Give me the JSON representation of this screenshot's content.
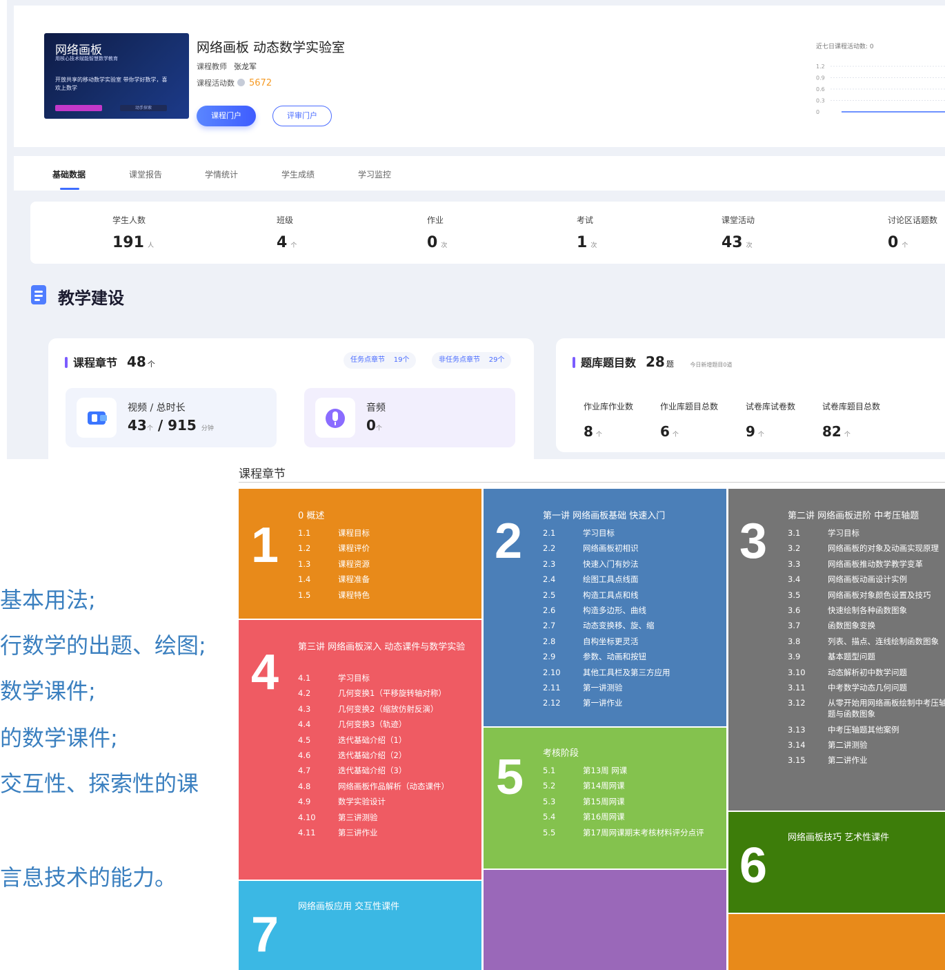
{
  "header": {
    "thumbnail": {
      "title": "网络画板",
      "subtitle": "用核心技术赋能智慧数学教育",
      "slogan": "开放共享的移动数学实验室 带你学好数学，喜欢上数学",
      "button_right": "动手探索"
    },
    "course_title": "网络画板 动态数学实验室",
    "teacher_label": "课程教师",
    "teacher_name": "张龙军",
    "activity_label": "课程活动数",
    "activity_value": "5672",
    "primary_button": "课程门户",
    "secondary_button": "评审门户",
    "mini_chart": {
      "caption": "近七日课程活动数: 0",
      "y_ticks": [
        "1.2",
        "0.9",
        "0.6",
        "0.3",
        "0"
      ]
    }
  },
  "tabs": [
    {
      "label": "基础数据",
      "active": true
    },
    {
      "label": "课堂报告",
      "active": false
    },
    {
      "label": "学情统计",
      "active": false
    },
    {
      "label": "学生成绩",
      "active": false
    },
    {
      "label": "学习监控",
      "active": false
    }
  ],
  "stats": [
    {
      "label": "学生人数",
      "value": "191",
      "unit": "人"
    },
    {
      "label": "班级",
      "value": "4",
      "unit": "个"
    },
    {
      "label": "作业",
      "value": "0",
      "unit": "次"
    },
    {
      "label": "考试",
      "value": "1",
      "unit": "次"
    },
    {
      "label": "课堂活动",
      "value": "43",
      "unit": "次"
    },
    {
      "label": "讨论区话题数",
      "value": "0",
      "unit": "个"
    }
  ],
  "section_title": "教学建设",
  "chapters_card": {
    "title": "课程章节",
    "count": "48",
    "count_unit": "个",
    "pill_task": "任务点章节",
    "pill_task_value": "19个",
    "pill_nontask": "非任务点章节",
    "pill_nontask_value": "29个",
    "video_label": "视频 / 总时长",
    "video_count": "43",
    "video_count_unit": "个",
    "video_duration": "915",
    "video_duration_unit": "分钟",
    "audio_label": "音频",
    "audio_value": "0",
    "audio_unit": "个"
  },
  "question_bank": {
    "title": "题库题目数",
    "count": "28",
    "count_unit": "题",
    "today": "今日新增题目0道",
    "stats": [
      {
        "label": "作业库作业数",
        "value": "8",
        "unit": "个"
      },
      {
        "label": "作业库题目总数",
        "value": "6",
        "unit": "个"
      },
      {
        "label": "试卷库试卷数",
        "value": "9",
        "unit": "个"
      },
      {
        "label": "试卷库题目总数",
        "value": "82",
        "unit": "个"
      }
    ]
  },
  "left_text": [
    "基本用法;",
    "行数学的出题、绘图;",
    "数学课件;",
    "的数学课件;",
    "交互性、探索性的课",
    "言息技术的能力。"
  ],
  "chapter_tiles": {
    "title": "课程章节",
    "tiles": [
      {
        "number": "1",
        "color": "#e88a1a",
        "heading": "0 概述",
        "items": [
          {
            "no": "1.1",
            "text": "课程目标"
          },
          {
            "no": "1.2",
            "text": "课程评价"
          },
          {
            "no": "1.3",
            "text": "课程资源"
          },
          {
            "no": "1.4",
            "text": "课程准备"
          },
          {
            "no": "1.5",
            "text": "课程特色"
          }
        ]
      },
      {
        "number": "2",
        "color": "#4b7fb8",
        "heading": "第一讲 网络画板基础 快速入门",
        "items": [
          {
            "no": "2.1",
            "text": "学习目标"
          },
          {
            "no": "2.2",
            "text": "网络画板初相识"
          },
          {
            "no": "2.3",
            "text": "快速入门有妙法"
          },
          {
            "no": "2.4",
            "text": "绘图工具点线面"
          },
          {
            "no": "2.5",
            "text": "构造工具点和线"
          },
          {
            "no": "2.6",
            "text": "构造多边形、曲线"
          },
          {
            "no": "2.7",
            "text": "动态变换移、旋、缩"
          },
          {
            "no": "2.8",
            "text": "自构坐标更灵活"
          },
          {
            "no": "2.9",
            "text": "参数、动画和按钮"
          },
          {
            "no": "2.10",
            "text": "其他工具栏及第三方应用"
          },
          {
            "no": "2.11",
            "text": "第一讲测验"
          },
          {
            "no": "2.12",
            "text": "第一讲作业"
          }
        ]
      },
      {
        "number": "3",
        "color": "#757575",
        "heading": "第二讲 网络画板进阶 中考压轴题",
        "items": [
          {
            "no": "3.1",
            "text": "学习目标"
          },
          {
            "no": "3.2",
            "text": "网络画板的对象及动画实现原理"
          },
          {
            "no": "3.3",
            "text": "网络画板推动数学教学变革"
          },
          {
            "no": "3.4",
            "text": "网络画板动画设计实例"
          },
          {
            "no": "3.5",
            "text": "网络画板对象颜色设置及技巧"
          },
          {
            "no": "3.6",
            "text": "快速绘制各种函数图象"
          },
          {
            "no": "3.7",
            "text": "函数图象变换"
          },
          {
            "no": "3.8",
            "text": "列表、描点、连线绘制函数图象"
          },
          {
            "no": "3.9",
            "text": "基本题型问题"
          },
          {
            "no": "3.10",
            "text": "动态解析初中数学问题"
          },
          {
            "no": "3.11",
            "text": "中考数学动态几何问题"
          },
          {
            "no": "3.12",
            "text": "从零开始用网络画板绘制中考压轴题与函数图象"
          },
          {
            "no": "3.13",
            "text": "中考压轴题其他案例"
          },
          {
            "no": "3.14",
            "text": "第二讲测验"
          },
          {
            "no": "3.15",
            "text": "第二讲作业"
          }
        ]
      },
      {
        "number": "4",
        "color": "#ef5b63",
        "heading": "第三讲 网络画板深入 动态课件与数学实验",
        "items": [
          {
            "no": "4.1",
            "text": "学习目标"
          },
          {
            "no": "4.2",
            "text": "几何变换1（平移旋转轴对称）"
          },
          {
            "no": "4.3",
            "text": "几何变换2（缩放仿射反演）"
          },
          {
            "no": "4.4",
            "text": "几何变换3（轨迹）"
          },
          {
            "no": "4.5",
            "text": "迭代基础介绍（1）"
          },
          {
            "no": "4.6",
            "text": "迭代基础介绍（2）"
          },
          {
            "no": "4.7",
            "text": "迭代基础介绍（3）"
          },
          {
            "no": "4.8",
            "text": "网络画板作品解析（动态课件）"
          },
          {
            "no": "4.9",
            "text": "数学实验设计"
          },
          {
            "no": "4.10",
            "text": "第三讲测验"
          },
          {
            "no": "4.11",
            "text": "第三讲作业"
          }
        ]
      },
      {
        "number": "5",
        "color": "#84c24e",
        "heading": "考核阶段",
        "items": [
          {
            "no": "5.1",
            "text": "第13周 网课"
          },
          {
            "no": "5.2",
            "text": "第14周网课"
          },
          {
            "no": "5.3",
            "text": "第15周网课"
          },
          {
            "no": "5.4",
            "text": "第16周网课"
          },
          {
            "no": "5.5",
            "text": "第17周网课期末考核材料评分点评"
          }
        ]
      },
      {
        "number": "6",
        "color": "#3d7d0a",
        "heading": "网络画板技巧 艺术性课件",
        "items": []
      },
      {
        "number": "7",
        "color": "#3bb8e4",
        "heading": "网络画板应用 交互性课件",
        "items": []
      }
    ],
    "filler_colors": {
      "purple": "#9a68b9",
      "orange": "#e88a1a"
    }
  }
}
